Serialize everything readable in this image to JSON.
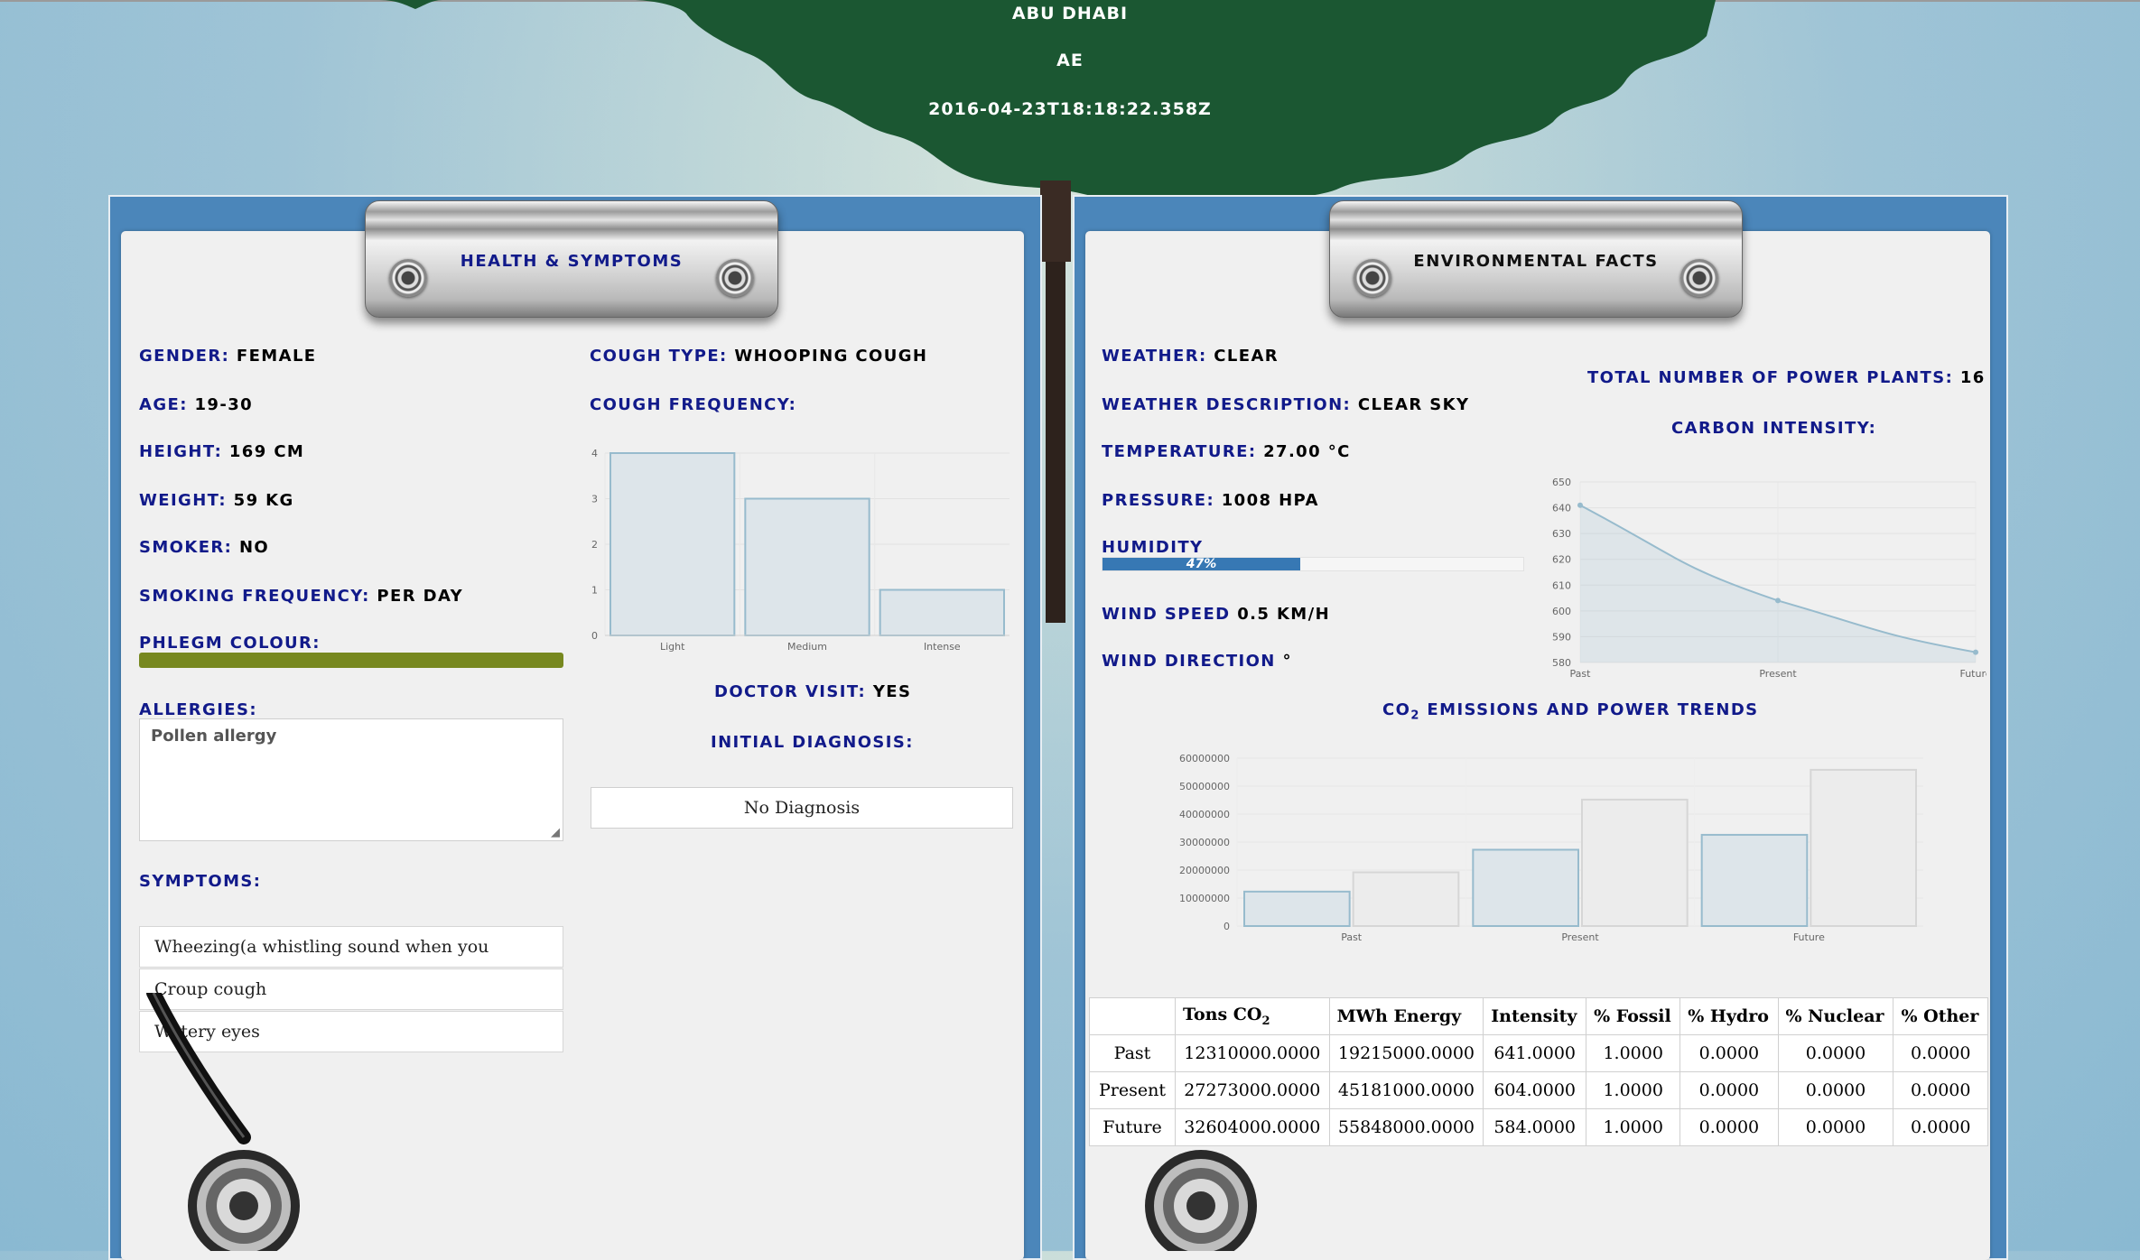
{
  "location": {
    "city": "ABU DHABI",
    "country": "AE",
    "timestamp": "2016-04-23T18:18:22.358Z"
  },
  "health": {
    "title": "HEALTH & SYMPTOMS",
    "gender": {
      "label": "GENDER:",
      "value": "FEMALE"
    },
    "age": {
      "label": "AGE:",
      "value": "19-30"
    },
    "height": {
      "label": "HEIGHT:",
      "value": "169 CM"
    },
    "weight": {
      "label": "WEIGHT:",
      "value": "59 KG"
    },
    "smoker": {
      "label": "SMOKER:",
      "value": "NO"
    },
    "smoking_frequency": {
      "label": "SMOKING FREQUENCY:",
      "value": "PER DAY"
    },
    "phlegm_colour": {
      "label": "PHLEGM COLOUR:",
      "color": "#77881f"
    },
    "allergies": {
      "label": "ALLERGIES:",
      "value": "Pollen allergy"
    },
    "symptoms_label": "SYMPTOMS:",
    "symptoms": [
      "Wheezing(a whistling sound when you breathe)",
      "Croup cough",
      "Watery eyes"
    ],
    "cough_type": {
      "label": "COUGH TYPE:",
      "value": "WHOOPING COUGH"
    },
    "cough_frequency_label": "COUGH FREQUENCY:",
    "doctor_visit": {
      "label": "DOCTOR VISIT:",
      "value": "YES"
    },
    "initial_diagnosis_label": "INITIAL DIAGNOSIS:",
    "diagnosis": "No Diagnosis"
  },
  "environment": {
    "title": "ENVIRONMENTAL FACTS",
    "weather": {
      "label": "WEATHER:",
      "value": "CLEAR"
    },
    "weather_description": {
      "label": "WEATHER DESCRIPTION:",
      "value": "CLEAR SKY"
    },
    "temperature": {
      "label": "TEMPERATURE:",
      "value": "27.00 °C"
    },
    "pressure": {
      "label": "PRESSURE:",
      "value": "1008 HPA"
    },
    "humidity": {
      "label": "HUMIDITY",
      "percent": 47,
      "text": "47%"
    },
    "wind_speed": {
      "label": "WIND SPEED",
      "value": "0.5 KM/H"
    },
    "wind_direction": {
      "label": "WIND DIRECTION",
      "value": "°"
    },
    "power_plants": {
      "label": "TOTAL NUMBER OF POWER PLANTS:",
      "value": "16"
    },
    "carbon_intensity_label": "CARBON INTENSITY:",
    "emissions_title_prefix": "CO",
    "emissions_title_sub": "2",
    "emissions_title_suffix": " EMISSIONS AND POWER TRENDS",
    "table": {
      "headers": [
        "",
        "Tons CO2",
        "MWh Energy",
        "Intensity",
        "% Fossil",
        "% Hydro",
        "% Nuclear",
        "% Other"
      ],
      "rows": [
        [
          "Past",
          "12310000.0000",
          "19215000.0000",
          "641.0000",
          "1.0000",
          "0.0000",
          "0.0000",
          "0.0000"
        ],
        [
          "Present",
          "27273000.0000",
          "45181000.0000",
          "604.0000",
          "1.0000",
          "0.0000",
          "0.0000",
          "0.0000"
        ],
        [
          "Future",
          "32604000.0000",
          "55848000.0000",
          "584.0000",
          "1.0000",
          "0.0000",
          "0.0000",
          "0.0000"
        ]
      ]
    }
  },
  "colors": {
    "label_blue": "#111a8a",
    "board_blue": "#4b86ba",
    "bar_fill": "#dde5ea",
    "bar_stroke": "#97bbcd"
  },
  "chart_data": [
    {
      "type": "bar",
      "categories": [
        "Light",
        "Medium",
        "Intense"
      ],
      "values": [
        4,
        3,
        1
      ],
      "title": "",
      "ylim": [
        0,
        4
      ],
      "yticks": [
        "0",
        "1",
        "2",
        "3",
        "4"
      ]
    },
    {
      "type": "area",
      "x": [
        "Past",
        "Present",
        "Future"
      ],
      "values": [
        641,
        604,
        584
      ],
      "title": "",
      "ylim": [
        580,
        650
      ],
      "yticks": [
        "580",
        "590",
        "600",
        "610",
        "620",
        "630",
        "640",
        "650"
      ]
    },
    {
      "type": "bar",
      "categories": [
        "Past",
        "Present",
        "Future"
      ],
      "series": [
        {
          "values": [
            12310000,
            27273000,
            32604000
          ]
        },
        {
          "values": [
            19215000,
            45181000,
            55848000
          ]
        }
      ],
      "title": "",
      "ylim": [
        0,
        60000000
      ],
      "yticks": [
        "0",
        "10000000",
        "20000000",
        "30000000",
        "40000000",
        "50000000",
        "60000000"
      ]
    }
  ]
}
